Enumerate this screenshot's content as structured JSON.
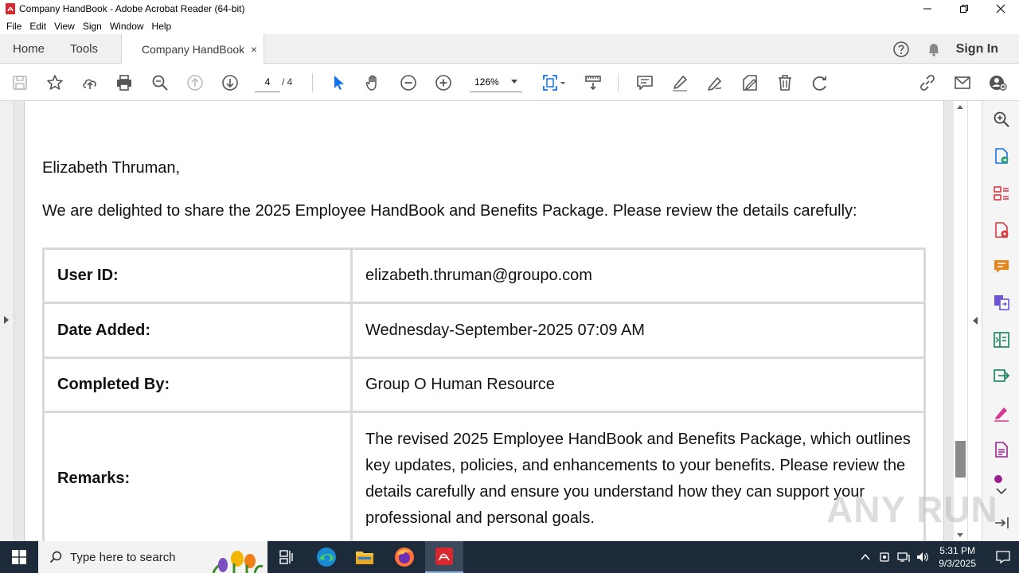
{
  "window": {
    "title": "Company HandBook - Adobe Acrobat Reader (64-bit)"
  },
  "menu": [
    "File",
    "Edit",
    "View",
    "Sign",
    "Window",
    "Help"
  ],
  "tabs": {
    "home": "Home",
    "tools": "Tools",
    "document": "Company HandBook",
    "close_glyph": "×"
  },
  "header": {
    "sign_in": "Sign In"
  },
  "toolbar": {
    "current_page": "4",
    "total_pages": "/ 4",
    "zoom": "126%"
  },
  "document": {
    "greeting": "Elizabeth Thruman,",
    "intro": "We are delighted to share the 2025 Employee HandBook and Benefits Package. Please review the details carefully:",
    "rows": [
      {
        "label": "User ID:",
        "value": "elizabeth.thruman@groupo.com"
      },
      {
        "label": "Date Added:",
        "value": "Wednesday-September-2025 07:09 AM"
      },
      {
        "label": "Completed By:",
        "value": "Group O Human Resource"
      },
      {
        "label": "Remarks:",
        "value": "The revised 2025 Employee HandBook and Benefits Package, which outlines key updates, policies, and enhancements to your benefits. Please review the details carefully and ensure you understand how they can support your professional and personal goals."
      }
    ]
  },
  "watermark": "ANY RUN",
  "taskbar": {
    "search_placeholder": "Type here to search",
    "time": "5:31 PM",
    "date": "9/3/2025"
  },
  "colors": {
    "acrobat_red": "#d7282f",
    "taskbar_bg": "#1c2a3a",
    "right_pane_icons": [
      "#1473e6",
      "#2d9d78",
      "#d7373f",
      "#e68619",
      "#6e52d9",
      "#12805c",
      "#1473e6",
      "#d83790",
      "#9b1f8e"
    ]
  }
}
